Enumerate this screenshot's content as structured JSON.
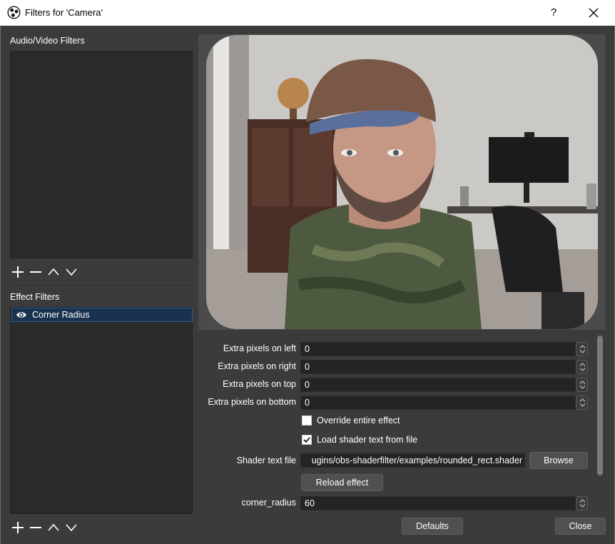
{
  "window": {
    "title": "Filters for 'Camera'",
    "help_label": "?",
    "icons": {
      "app": "obs-logo-icon",
      "close": "close-icon"
    }
  },
  "audio_video_filters": {
    "label": "Audio/Video Filters",
    "items": []
  },
  "effect_filters": {
    "label": "Effect Filters",
    "items": [
      {
        "name": "Corner Radius",
        "visible": true,
        "selected": true,
        "icon": "eye-icon"
      }
    ]
  },
  "toolbar_icons": [
    "plus-icon",
    "minus-icon",
    "chevron-up-icon",
    "chevron-down-icon"
  ],
  "properties": {
    "extra_left": {
      "label": "Extra pixels on left",
      "value": "0"
    },
    "extra_right": {
      "label": "Extra pixels on right",
      "value": "0"
    },
    "extra_top": {
      "label": "Extra pixels on top",
      "value": "0"
    },
    "extra_bottom": {
      "label": "Extra pixels on bottom",
      "value": "0"
    },
    "override": {
      "label": "Override entire effect",
      "checked": false
    },
    "load_from_file": {
      "label": "Load shader text from file",
      "checked": true
    },
    "shader_file": {
      "label": "Shader text file",
      "value": "ugins/obs-shaderfilter/examples/rounded_rect.shader"
    },
    "browse_label": "Browse",
    "reload_label": "Reload effect",
    "corner_radius": {
      "label": "corner_radius",
      "value": "60"
    }
  },
  "footer": {
    "defaults_label": "Defaults",
    "close_label": "Close"
  },
  "colors": {
    "background": "#3b3b3b",
    "list_bg": "#2a2a2a",
    "selection": "#19334f",
    "input_bg": "#242424",
    "button": "#505050"
  }
}
